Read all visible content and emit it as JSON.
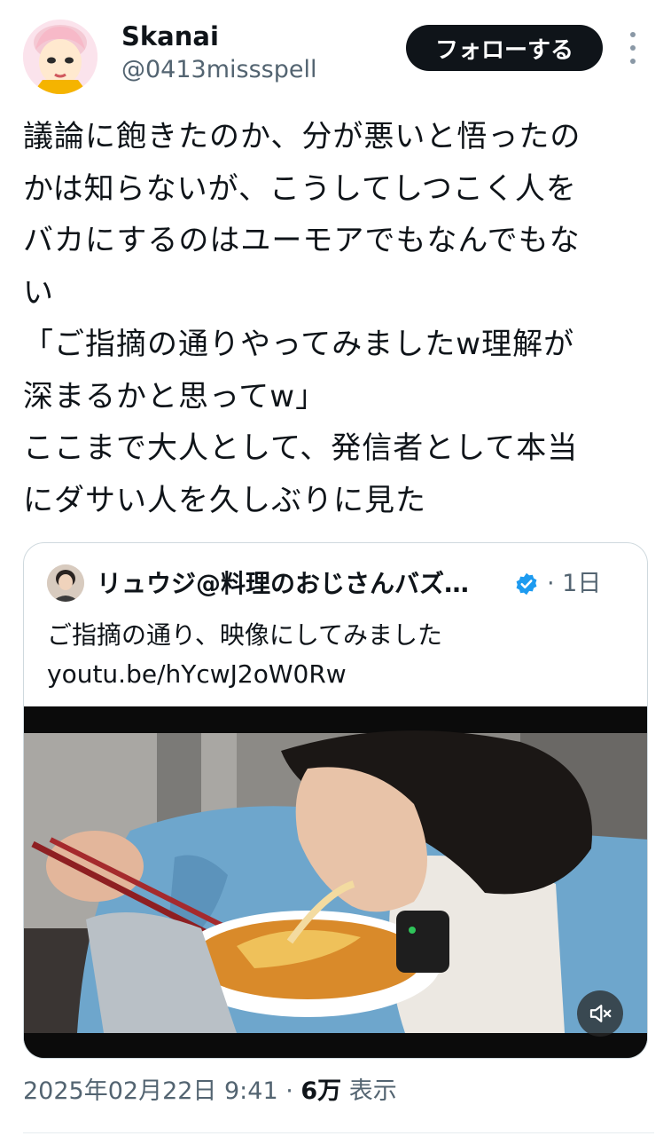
{
  "author": {
    "display_name": "Skanai",
    "handle": "@0413missspell"
  },
  "follow_button_label": "フォローする",
  "tweet_lines": [
    "議論に飽きたのか、分が悪いと悟ったの",
    "かは知らないが、こうしてしつこく人を",
    "バカにするのはユーモアでもなんでもな",
    "い",
    "「ご指摘の通りやってみましたw理解が",
    "深まるかと思ってw」",
    "ここまで大人として、発信者として本当",
    "にダサい人を久しぶりに見た"
  ],
  "quote": {
    "author_name": "リュウジ@料理のおじさんバズ…",
    "time": "· 1日",
    "text": "ご指摘の通り、映像にしてみました",
    "link": "youtu.be/hYcwJ2oW0Rw"
  },
  "meta": {
    "date": "2025年02月22日 9:41 · ",
    "views": "6万",
    "views_label": " 表示"
  },
  "icons": {
    "more": "more-vertical-icon",
    "verified": "verified-badge-icon",
    "mute": "muted-speaker-icon"
  },
  "colors": {
    "text": "#0f1419",
    "secondary": "#536471",
    "verified": "#1d9bf0",
    "follow_bg": "#0f1419"
  }
}
